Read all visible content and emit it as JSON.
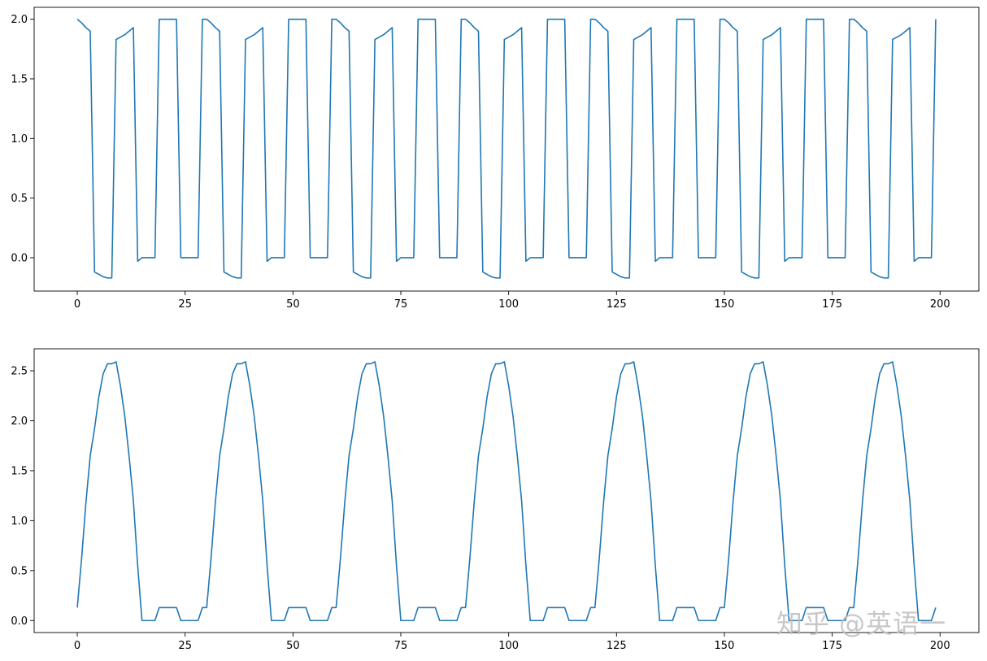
{
  "colors": {
    "line": "#1f77b4",
    "axes": "#000000",
    "background": "#ffffff"
  },
  "watermark": {
    "text": "知乎 @英语一"
  },
  "chart_data": [
    {
      "type": "line",
      "xlim": [
        -10,
        209
      ],
      "ylim": [
        -0.28,
        2.1
      ],
      "xticks": [
        0,
        25,
        50,
        75,
        100,
        125,
        150,
        175,
        200
      ],
      "xtick_labels": [
        "0",
        "25",
        "50",
        "75",
        "100",
        "125",
        "150",
        "175",
        "200"
      ],
      "yticks": [
        0.0,
        0.5,
        1.0,
        1.5,
        2.0
      ],
      "ytick_labels": [
        "0.0",
        "0.5",
        "1.0",
        "1.5",
        "2.0"
      ],
      "grid": false,
      "series": [
        {
          "period": 30,
          "x": [
            0,
            1,
            2,
            3,
            4,
            5,
            6,
            7,
            8,
            9,
            10,
            11,
            12,
            13,
            14,
            15,
            16,
            17,
            18,
            19,
            20,
            21,
            22,
            23,
            24,
            25,
            26,
            27,
            28,
            29
          ],
          "values": [
            2.0,
            1.97,
            1.93,
            1.9,
            -0.12,
            -0.14,
            -0.16,
            -0.17,
            -0.17,
            1.83,
            1.85,
            1.87,
            1.9,
            1.93,
            -0.03,
            0.0,
            0.0,
            0.0,
            0.0,
            2.0,
            2.0,
            2.0,
            2.0,
            2.0,
            0.0,
            0.0,
            0.0,
            0.0,
            0.0,
            2.0
          ]
        }
      ]
    },
    {
      "type": "line",
      "xlim": [
        -10,
        209
      ],
      "ylim": [
        -0.12,
        2.72
      ],
      "xticks": [
        0,
        25,
        50,
        75,
        100,
        125,
        150,
        175,
        200
      ],
      "xtick_labels": [
        "0",
        "25",
        "50",
        "75",
        "100",
        "125",
        "150",
        "175",
        "200"
      ],
      "yticks": [
        0.0,
        0.5,
        1.0,
        1.5,
        2.0,
        2.5
      ],
      "ytick_labels": [
        "0.0",
        "0.5",
        "1.0",
        "1.5",
        "2.0",
        "2.5"
      ],
      "grid": false,
      "series": [
        {
          "period": 30,
          "x": [
            0,
            1,
            2,
            3,
            4,
            5,
            6,
            7,
            8,
            9,
            10,
            11,
            12,
            13,
            14,
            15,
            16,
            17,
            18,
            19,
            20,
            21,
            22,
            23,
            24,
            25,
            26,
            27,
            28,
            29
          ],
          "values": [
            0.13,
            0.62,
            1.18,
            1.65,
            1.92,
            2.24,
            2.47,
            2.57,
            2.57,
            2.59,
            2.35,
            2.05,
            1.65,
            1.2,
            0.55,
            0.0,
            0.0,
            0.0,
            0.0,
            0.13,
            0.13,
            0.13,
            0.13,
            0.13,
            0.0,
            0.0,
            0.0,
            0.0,
            0.0,
            0.13
          ]
        }
      ]
    }
  ]
}
